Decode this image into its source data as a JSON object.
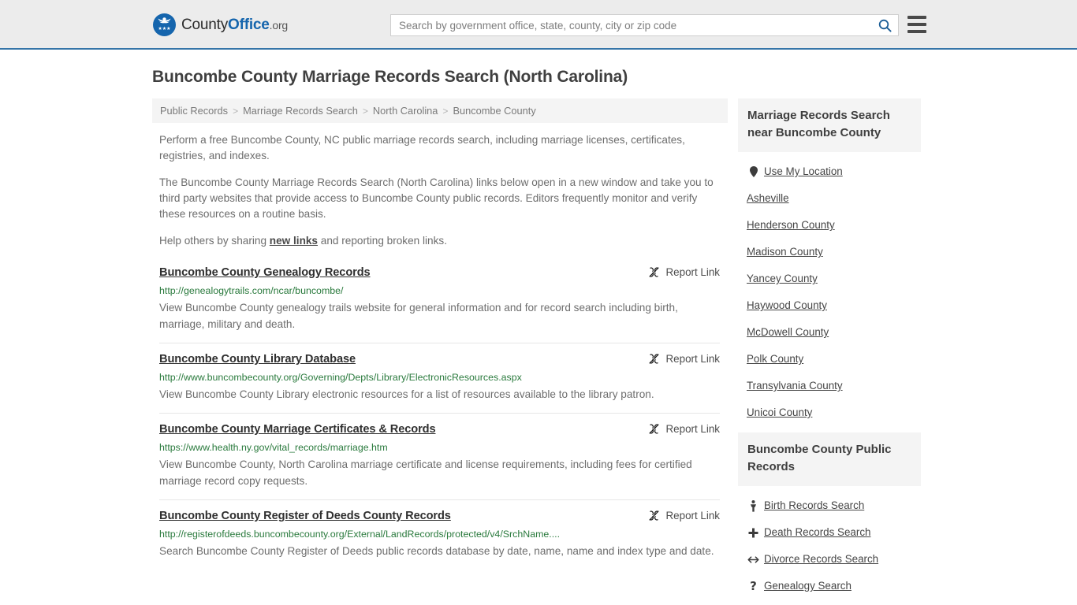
{
  "header": {
    "brand": {
      "part1": "County",
      "part2": "Office",
      "part3": ".org"
    },
    "search": {
      "placeholder": "Search by government office, state, county, city or zip code",
      "value": ""
    },
    "search_icon": "search-icon",
    "menu_icon": "hamburger-menu-icon"
  },
  "page_title": "Buncombe County Marriage Records Search (North Carolina)",
  "breadcrumb": {
    "separator": ">",
    "items": [
      {
        "label": "Public Records"
      },
      {
        "label": "Marriage Records Search"
      },
      {
        "label": "North Carolina"
      },
      {
        "label": "Buncombe County"
      }
    ]
  },
  "intro": {
    "p1": "Perform a free Buncombe County, NC public marriage records search, including marriage licenses, certificates, registries, and indexes.",
    "p2": "The Buncombe County Marriage Records Search (North Carolina) links below open in a new window and take you to third party websites that provide access to Buncombe County public records. Editors frequently monitor and verify these resources on a routine basis.",
    "p3_before": "Help others by sharing ",
    "p3_link": "new links",
    "p3_after": " and reporting broken links."
  },
  "report_link_label": "Report Link",
  "report_link_icon": "broken-link-icon",
  "results": [
    {
      "title": "Buncombe County Genealogy Records",
      "url": "http://genealogytrails.com/ncar/buncombe/",
      "description": "View Buncombe County genealogy trails website for general information and for record search including birth, marriage, military and death."
    },
    {
      "title": "Buncombe County Library Database",
      "url": "http://www.buncombecounty.org/Governing/Depts/Library/ElectronicResources.aspx",
      "description": "View Buncombe County Library electronic resources for a list of resources available to the library patron."
    },
    {
      "title": "Buncombe County Marriage Certificates & Records",
      "url": "https://www.health.ny.gov/vital_records/marriage.htm",
      "description": "View Buncombe County, North Carolina marriage certificate and license requirements, including fees for certified marriage record copy requests."
    },
    {
      "title": "Buncombe County Register of Deeds County Records",
      "url": "http://registerofdeeds.buncombecounty.org/External/LandRecords/protected/v4/SrchName....",
      "description": "Search Buncombe County Register of Deeds public records database by date, name, name and index type and date."
    }
  ],
  "sidebar": {
    "nearby": {
      "heading": "Marriage Records Search near Buncombe County",
      "items": [
        {
          "label": "Use My Location",
          "icon": "map-pin-icon"
        },
        {
          "label": "Asheville",
          "icon": ""
        },
        {
          "label": "Henderson County",
          "icon": ""
        },
        {
          "label": "Madison County",
          "icon": ""
        },
        {
          "label": "Yancey County",
          "icon": ""
        },
        {
          "label": "Haywood County",
          "icon": ""
        },
        {
          "label": "McDowell County",
          "icon": ""
        },
        {
          "label": "Polk County",
          "icon": ""
        },
        {
          "label": "Transylvania County",
          "icon": ""
        },
        {
          "label": "Unicoi County",
          "icon": ""
        }
      ]
    },
    "public_records": {
      "heading": "Buncombe County Public Records",
      "items": [
        {
          "label": "Birth Records Search",
          "icon": "baby-icon",
          "glyph": "ـ"
        },
        {
          "label": "Death Records Search",
          "icon": "cross-icon",
          "glyph": "➕"
        },
        {
          "label": "Divorce Records Search",
          "icon": "left-right-arrow-icon",
          "glyph": "↔"
        },
        {
          "label": "Genealogy Search",
          "icon": "question-mark-icon",
          "glyph": "?"
        }
      ]
    }
  },
  "colors": {
    "header_bg": "#ececec",
    "header_border": "#3575a8",
    "brand_blue": "#1565ad",
    "url_green": "#2a7a3d",
    "panel_gray": "#f4f4f4",
    "text_gray": "#6d6d6d"
  }
}
